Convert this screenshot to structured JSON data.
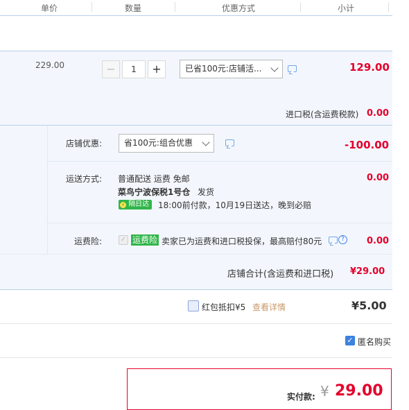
{
  "header": {
    "col_price": "单价",
    "col_qty": "数量",
    "col_discount": "优惠方式",
    "col_subtotal": "小计"
  },
  "item": {
    "price": "229.00",
    "quantity": "1",
    "discount_select": "已省100元:店铺活...",
    "subtotal": "129.00",
    "import_tax_label": "进口税(含运费税款)",
    "import_tax_value": "0.00"
  },
  "shop": {
    "discount_label": "店铺优惠:",
    "discount_select": "省100元:组合优惠",
    "discount_value": "-100.00",
    "shipping_label": "运送方式:",
    "shipping_line1": "普通配送 运费 免邮",
    "shipping_warehouse": "菜鸟宁波保税1号仓",
    "shipping_ship": "发货",
    "shipping_badge": "隔日达",
    "shipping_note": "18:00前付款，10月19日送达，晚到必赔",
    "shipping_value": "0.00",
    "insurance_label": "运费险:",
    "insurance_badge": "运费险",
    "insurance_text": "卖家已为运费和进口税投保，最高赔付80元",
    "insurance_value": "0.00",
    "total_label": "店铺合计(含运费和进口税)",
    "total_value": "¥29.00"
  },
  "redpacket": {
    "label": "红包抵扣¥5",
    "link": "查看详情",
    "value": "¥5.00"
  },
  "anonymous": {
    "label": "匿名购买"
  },
  "payment": {
    "label": "实付款:",
    "currency": "¥",
    "value": "29.00"
  },
  "colors": {
    "accent_red": "#e4002b",
    "link_blue": "#3c82e0",
    "badge_green": "#31b54a",
    "panel_blue": "#f3f7fd"
  }
}
